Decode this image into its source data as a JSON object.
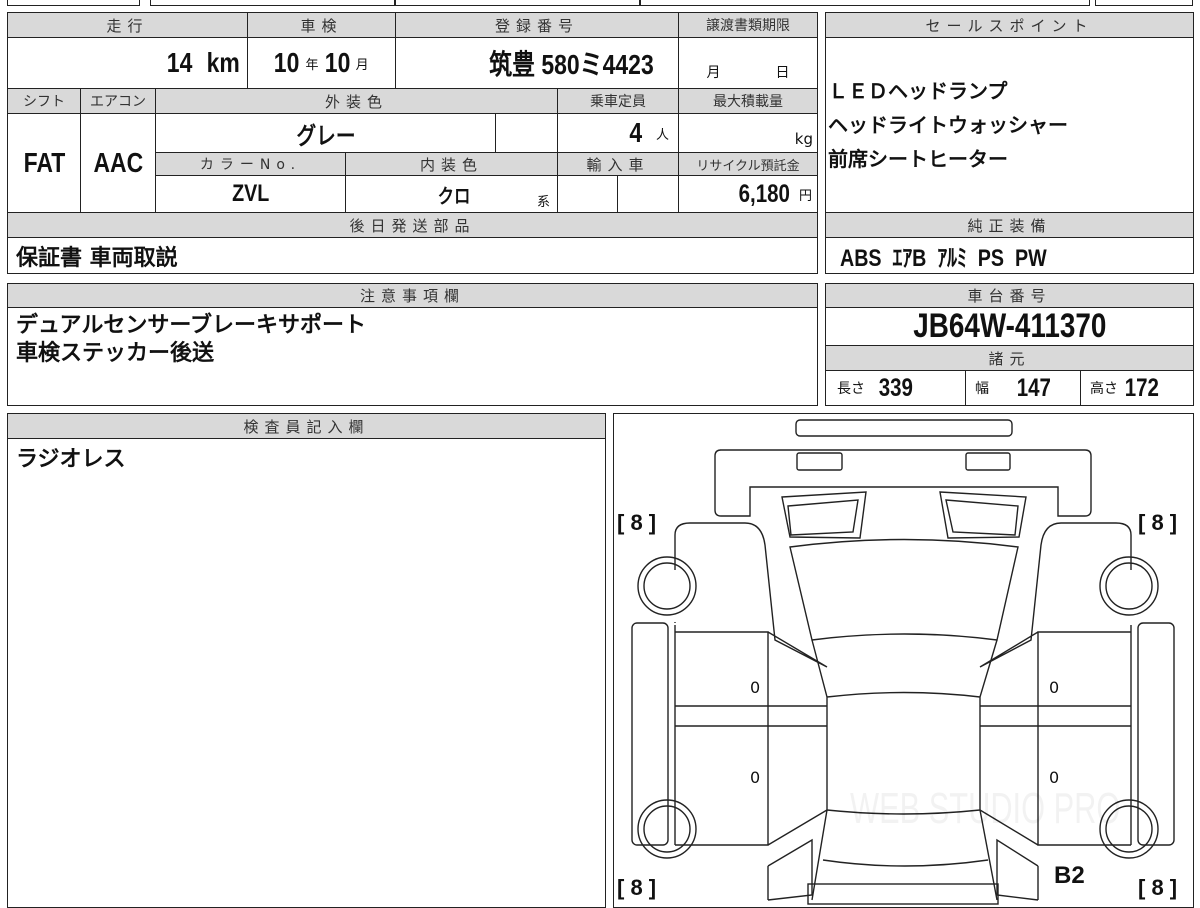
{
  "mileage": {
    "label": "走行",
    "value": "14",
    "unit": "km"
  },
  "inspection": {
    "label": "車検",
    "year": "10",
    "year_unit": "年",
    "month": "10",
    "month_unit": "月"
  },
  "registration": {
    "label": "登録番号",
    "value": "筑豊 580ミ4423"
  },
  "transfer_deadline": {
    "label": "譲渡書類期限",
    "month_unit": "月",
    "day_unit": "日"
  },
  "shift": {
    "label": "シフト",
    "value": "FAT"
  },
  "aircon": {
    "label": "エアコン",
    "value": "AAC"
  },
  "exterior_color": {
    "label": "外装色",
    "value": "グレー"
  },
  "capacity": {
    "label": "乗車定員",
    "value": "4",
    "unit": "人"
  },
  "max_load": {
    "label": "最大積載量",
    "unit": "kg"
  },
  "color_no": {
    "label": "カラーNo.",
    "value": "ZVL"
  },
  "interior_color": {
    "label": "内装色",
    "value": "クロ",
    "suffix": "系"
  },
  "imported": {
    "label": "輸入車"
  },
  "recycle": {
    "label": "リサイクル預託金",
    "value": "6,180",
    "unit": "円"
  },
  "later_parts": {
    "label": "後日発送部品",
    "value": "保証書 車両取説"
  },
  "sales_points": {
    "label": "セールスポイント",
    "items": [
      "ＬＥＤヘッドランプ",
      "ヘッドライトウォッシャー",
      "前席シートヒーター"
    ]
  },
  "equipment": {
    "label": "純正装備",
    "value": "ABS  ｴｱB  ｱﾙﾐ  PS  PW"
  },
  "notes": {
    "label": "注意事項欄",
    "lines": [
      "デュアルセンサーブレーキサポート",
      "車検ステッカー後送"
    ]
  },
  "chassis": {
    "label": "車台番号",
    "value": "JB64W-411370"
  },
  "specs": {
    "label": "諸元",
    "length_label": "長さ",
    "length": "339",
    "width_label": "幅",
    "width": "147",
    "height_label": "高さ",
    "height": "172"
  },
  "inspector": {
    "label": "検査員記入欄",
    "value": "ラジオレス"
  },
  "diagram": {
    "tire_fl": "[ 8 ]",
    "tire_fr": "[ 8 ]",
    "tire_rl": "[ 8 ]",
    "tire_rr": "[ 8 ]",
    "mark_left_front": "0",
    "mark_left_rear": "0",
    "mark_right_front": "0",
    "mark_right_rear": "0",
    "mark_b2": "B2",
    "watermark": "WEB STUDIO PRO"
  }
}
